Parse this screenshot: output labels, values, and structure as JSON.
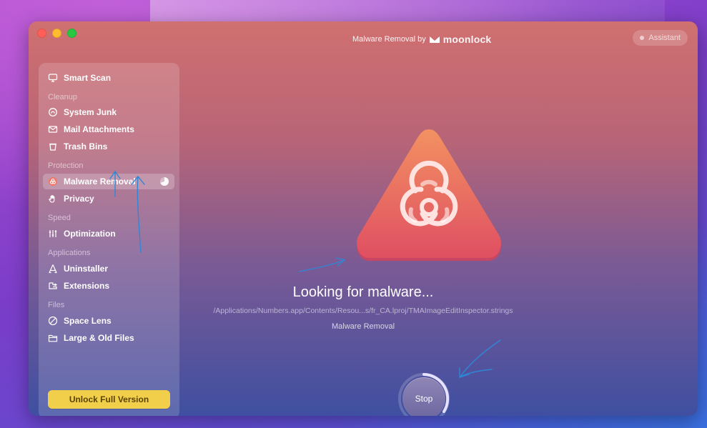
{
  "window": {
    "title_prefix": "Malware Removal by",
    "brand_name": "moonlock",
    "assistant_label": "Assistant"
  },
  "sidebar": {
    "items": [
      {
        "label": "Smart Scan",
        "icon": "monitor-icon"
      },
      {
        "section": "Cleanup"
      },
      {
        "label": "System Junk",
        "icon": "junk-icon"
      },
      {
        "label": "Mail Attachments",
        "icon": "mail-icon"
      },
      {
        "label": "Trash Bins",
        "icon": "trash-icon"
      },
      {
        "section": "Protection"
      },
      {
        "label": "Malware Removal",
        "icon": "biohazard-icon",
        "active": true
      },
      {
        "label": "Privacy",
        "icon": "hand-icon"
      },
      {
        "section": "Speed"
      },
      {
        "label": "Optimization",
        "icon": "sliders-icon"
      },
      {
        "section": "Applications"
      },
      {
        "label": "Uninstaller",
        "icon": "uninstaller-icon"
      },
      {
        "label": "Extensions",
        "icon": "extensions-icon"
      },
      {
        "section": "Files"
      },
      {
        "label": "Space Lens",
        "icon": "space-lens-icon"
      },
      {
        "label": "Large & Old Files",
        "icon": "folder-icon"
      }
    ],
    "unlock_label": "Unlock Full Version"
  },
  "main": {
    "status_text": "Looking for malware...",
    "scan_path": "/Applications/Numbers.app/Contents/Resou...s/fr_CA.lproj/TMAImageEditInspector.strings",
    "module_label": "Malware Removal",
    "stop_label": "Stop"
  },
  "colors": {
    "accent": "#f2cf4b",
    "hero_top": "#f08a63",
    "hero_bottom": "#e0545e",
    "annotation": "#2f86d6"
  }
}
